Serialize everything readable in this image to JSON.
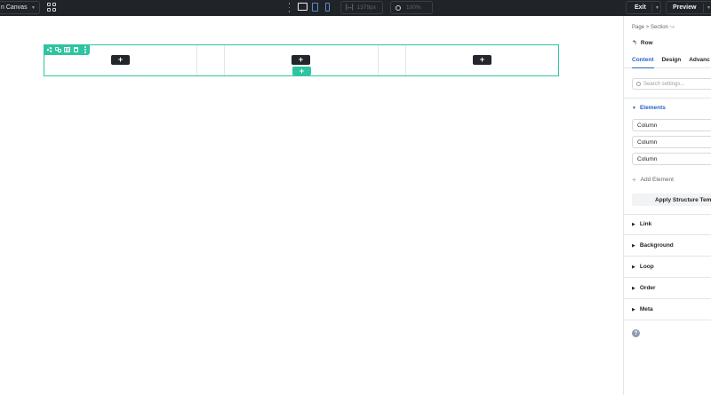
{
  "topbar": {
    "canvas_select_label": "n Canvas",
    "width_value": "1379px",
    "zoom_value": "100%",
    "exit_label": "Exit",
    "preview_label": "Preview"
  },
  "canvas": {
    "add_label": "+",
    "add_row_label": "+"
  },
  "panel": {
    "breadcrumb": "Page > Section",
    "back_label": "Row",
    "tabs": [
      "Content",
      "Design",
      "Advanc"
    ],
    "search_placeholder": "Search settings...",
    "elements_heading": "Elements",
    "columns": [
      "Column",
      "Column",
      "Column"
    ],
    "add_element_label": "Add Element",
    "apply_structure_label": "Apply Structure Temp",
    "sections": [
      "Link",
      "Background",
      "Loop",
      "Order",
      "Meta"
    ],
    "help_label": "?"
  },
  "colors": {
    "accent": "#2ec4a0",
    "link": "#2563c9",
    "topbar": "#202328"
  }
}
